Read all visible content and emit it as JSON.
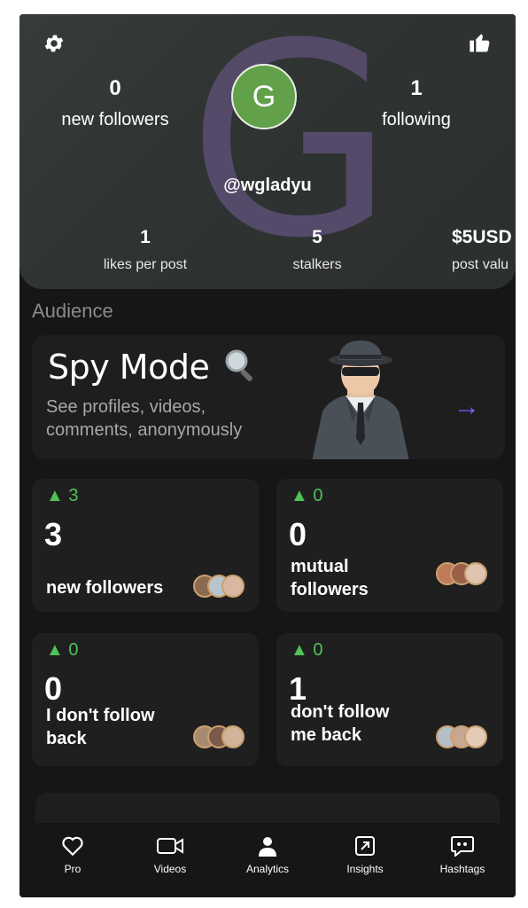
{
  "header": {
    "avatar_letter": "G",
    "watermark_letter": "G",
    "username": "@wgladyu",
    "left_stat": {
      "value": "0",
      "label": "new followers"
    },
    "right_stat": {
      "value": "1",
      "label": "following"
    },
    "row2": [
      {
        "value": "1",
        "label": "likes per post"
      },
      {
        "value": "5",
        "label": "stalkers"
      },
      {
        "value": "$5USD",
        "label": "post valu"
      }
    ]
  },
  "section_title": "Audience",
  "spy": {
    "title": "Spy Mode",
    "subtitle": "See profiles, videos, comments, anonymously",
    "arrow": "→"
  },
  "cards": [
    {
      "delta": "▲ 3",
      "value": "3",
      "label": "new followers"
    },
    {
      "delta": "▲ 0",
      "value": "0",
      "label": "mutual followers"
    },
    {
      "delta": "▲ 0",
      "value": "0",
      "label": "I don't follow back"
    },
    {
      "delta": "▲ 0",
      "value": "1",
      "label": "don't follow me back"
    }
  ],
  "tabs": [
    {
      "label": "Pro",
      "icon": "heart-icon"
    },
    {
      "label": "Videos",
      "icon": "video-camera-icon"
    },
    {
      "label": "Analytics",
      "icon": "person-icon"
    },
    {
      "label": "Insights",
      "icon": "insights-arrow-icon"
    },
    {
      "label": "Hashtags",
      "icon": "chat-quote-icon"
    }
  ],
  "colors": {
    "accent_green": "#4fc25a",
    "accent_purple": "#6f63ff",
    "avatar_green": "#62a04a",
    "background": "#161616"
  }
}
